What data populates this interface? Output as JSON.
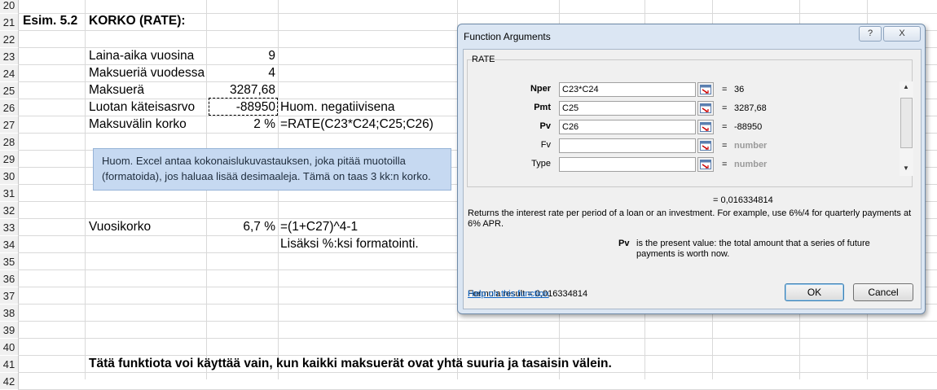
{
  "rows": [
    "20",
    "21",
    "22",
    "23",
    "24",
    "25",
    "26",
    "27",
    "28",
    "29",
    "30",
    "31",
    "32",
    "33",
    "34",
    "35",
    "36",
    "37",
    "38",
    "39",
    "40",
    "41",
    "42"
  ],
  "sheet": {
    "title_left": "Esim. 5.2",
    "title_right": "KORKO (RATE):",
    "laina_label": "Laina-aika vuosina",
    "laina_value": "9",
    "maksueria_label": "Maksueriä vuodessa",
    "maksueria_value": "4",
    "maksuera_label": "Maksuerä",
    "maksuera_value": "3287,68",
    "kateis_label": "Luotan käteisasrvo",
    "kateis_value": "-88950",
    "kateis_note": "Huom. negatiivisena",
    "korko_label": "Maksuvälin korko",
    "korko_value": "2 %",
    "korko_formula": "=RATE(C23*C24;C25;C26)",
    "note_text": "Huom. Excel antaa kokonaislukuvastauksen, joka pitää muotoilla (formatoida), jos haluaa lisää desimaaleja. Tämä on taas 3 kk:n korko.",
    "vuosikorko_label": "Vuosikorko",
    "vuosikorko_value": "6,7 %",
    "vuosikorko_formula": "=(1+C27)^4-1",
    "lisaksi": "Lisäksi %:ksi formatointi.",
    "footer": "Tätä funktiota voi käyttää vain, kun kaikki maksuerät ovat yhtä suuria ja tasaisin välein."
  },
  "dialog": {
    "title": "Function Arguments",
    "help_btn": "?",
    "close_btn": "X",
    "function_name": "RATE",
    "args": [
      {
        "label": "Nper",
        "value": "C23*C24",
        "result": "36"
      },
      {
        "label": "Pmt",
        "value": "C25",
        "result": "3287,68"
      },
      {
        "label": "Pv",
        "value": "C26",
        "result": "-88950"
      },
      {
        "label": "Fv",
        "value": "",
        "result": "number"
      },
      {
        "label": "Type",
        "value": "",
        "result": "number"
      }
    ],
    "eq_sign": "=",
    "total_result": "=  0,016334814",
    "description": "Returns the interest rate per period of a loan or an investment. For example, use 6%/4 for quarterly payments at 6% APR.",
    "pv_label": "Pv",
    "pv_desc": "is the present value: the total amount that a series of future payments is worth now.",
    "formula_result": "Formula result =   0,016334814",
    "help_link": "Help on this function",
    "ok": "OK",
    "cancel": "Cancel"
  }
}
